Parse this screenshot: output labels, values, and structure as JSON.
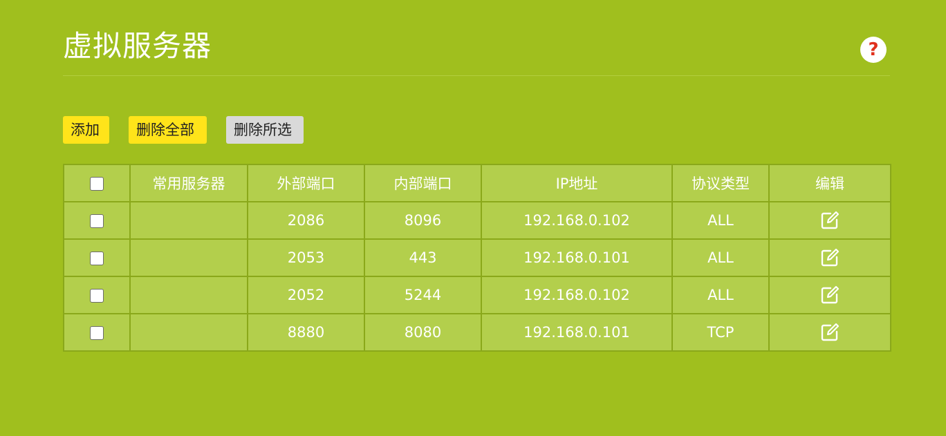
{
  "header": {
    "title": "虚拟服务器",
    "help_icon": "?"
  },
  "toolbar": {
    "add_label": "添加",
    "delete_all_label": "删除全部",
    "delete_selected_label": "删除所选"
  },
  "table": {
    "columns": [
      "常用服务器",
      "外部端口",
      "内部端口",
      "IP地址",
      "协议类型",
      "编辑"
    ],
    "rows": [
      {
        "service": "",
        "external_port": "2086",
        "internal_port": "8096",
        "ip": "192.168.0.102",
        "protocol": "ALL"
      },
      {
        "service": "",
        "external_port": "2053",
        "internal_port": "443",
        "ip": "192.168.0.101",
        "protocol": "ALL"
      },
      {
        "service": "",
        "external_port": "2052",
        "internal_port": "5244",
        "ip": "192.168.0.102",
        "protocol": "ALL"
      },
      {
        "service": "",
        "external_port": "8880",
        "internal_port": "8080",
        "ip": "192.168.0.101",
        "protocol": "TCP"
      }
    ]
  },
  "colors": {
    "background": "#a0bf1e",
    "table_bg": "#b3cf4c",
    "button_yellow": "#ffe41a",
    "button_gray": "#d9d9d9",
    "help_red": "#e0301e"
  },
  "icons": {
    "help": "question-mark-icon",
    "edit": "edit-icon"
  }
}
